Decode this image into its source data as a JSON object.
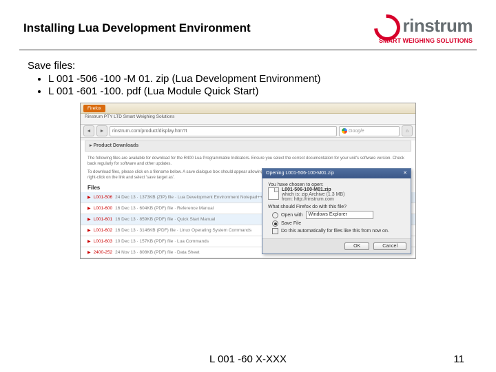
{
  "header": {
    "title": "Installing Lua Development Environment",
    "logo_text": "rinstrum",
    "logo_sub": "SMART WEIGHING SOLUTIONS"
  },
  "content": {
    "save_label": "Save files:",
    "bullets": [
      "L 001 -506 -100 -M 01. zip (Lua Development Environment)",
      "L 001 -601 -100. pdf (Lua Module Quick Start)"
    ]
  },
  "browser": {
    "firefox_label": "Firefox",
    "tab_title": "Rinstrum PTY LTD   Smart Weighing Solutions",
    "url": "rinstrum.com/product/display.htm?t",
    "search_placeholder": "Google",
    "section_title": "Product Downloads",
    "desc_lines": [
      "The following files are available for download for the R400 Lua Programmable Indicators. Ensure you select the correct documentation for your unit's software version. Check back regularly for software and other updates.",
      "To download files, please click on a filename below. A save dialogue box should appear allowing you to specify your save location. If a save dialogue box does not appear, right-click on the link and select 'save target as'."
    ],
    "files_heading": "Files",
    "files": [
      {
        "link": "L001-506",
        "rest": "24 Dec 13 · 1373KB (ZIP) file · Lua Development Environment Notepad++ and PuTTY",
        "hl": true
      },
      {
        "link": "L001-600",
        "rest": "16 Dec 13 · 604KB (PDF) file · Reference Manual",
        "hl": false
      },
      {
        "link": "L001-601",
        "rest": "16 Dec 13 · 859KB (PDF) file · Quick Start Manual",
        "hl": true
      },
      {
        "link": "L001-602",
        "rest": "16 Dec 13 · 3146KB (PDF) file · Linux Operating System Commands",
        "hl": false
      },
      {
        "link": "L001-603",
        "rest": "10 Dec 13 · 157KB (PDF) file · Lua Commands",
        "hl": false
      },
      {
        "link": "2400-252",
        "rest": "24 Nov 13 · 808KB (PDF) file · Data Sheet",
        "hl": false
      }
    ]
  },
  "dialog": {
    "title": "Opening L001-506-100-M01.zip",
    "chosen_label": "You have chosen to open:",
    "filename": "L001-506-100-M01.zip",
    "which_is": "which is: zip Archive (1.3 MB)",
    "from": "from: http://rinstrum.com",
    "question": "What should Firefox do with this file?",
    "open_with": "Open with",
    "open_app": "Windows Explorer",
    "save_file": "Save File",
    "remember": "Do this automatically for files like this from now on.",
    "ok": "OK",
    "cancel": "Cancel"
  },
  "footer": {
    "center": "L 001 -60 X-XXX",
    "page": "11"
  }
}
